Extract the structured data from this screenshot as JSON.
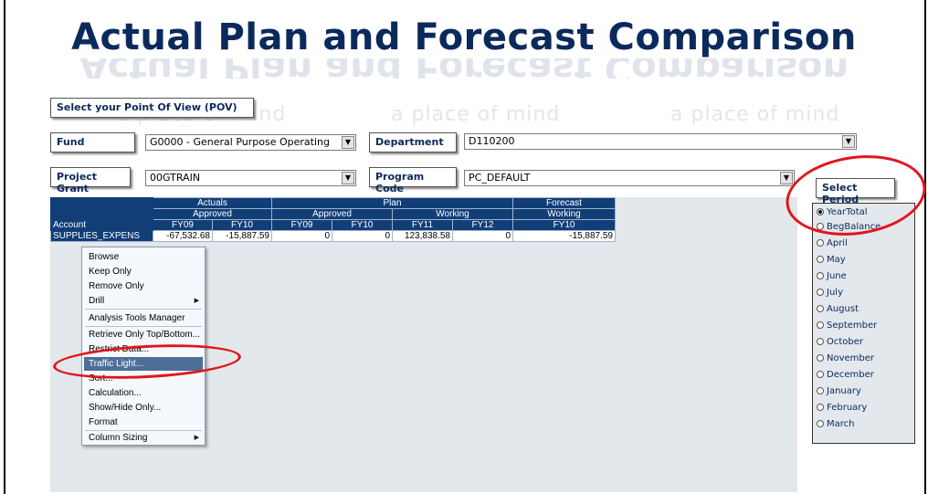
{
  "title": "Actual Plan and Forecast Comparison",
  "watermark": "a place of mind",
  "pov": {
    "label": "Select your Point Of View (POV)",
    "fund_label": "Fund",
    "fund_value": "G0000 - General Purpose Operating",
    "department_label": "Department",
    "department_value": "D110200",
    "project_label": "Project Grant",
    "project_value": "00GTRAIN",
    "program_label": "Program Code",
    "program_value": "PC_DEFAULT"
  },
  "grid": {
    "groups": [
      "Actuals",
      "Plan",
      "Forecast"
    ],
    "subgroups": [
      "Approved",
      "Approved",
      "Working",
      "Working"
    ],
    "account_header": "Account",
    "years": [
      "FY09",
      "FY10",
      "FY09",
      "FY10",
      "FY11",
      "FY12",
      "FY10"
    ],
    "row_label": "SUPPLIES_EXPENS",
    "row_values": [
      "-67,532.68",
      "-15,887.59",
      "0",
      "0",
      "123,838.58",
      "0",
      "-15,887.59"
    ]
  },
  "context_menu": {
    "items": [
      "Browse",
      "Keep Only",
      "Remove Only",
      "Drill",
      "Analysis Tools Manager",
      "Retrieve Only Top/Bottom...",
      "Restrict Data...",
      "Traffic Light...",
      "Sort...",
      "Calculation...",
      "Show/Hide Only...",
      "Format",
      "Column Sizing"
    ],
    "highlighted": "Traffic Light..."
  },
  "period": {
    "label": "Select Period",
    "options": [
      "YearTotal",
      "BegBalance",
      "April",
      "May",
      "June",
      "July",
      "August",
      "September",
      "October",
      "November",
      "December",
      "January",
      "February",
      "March"
    ],
    "selected": "YearTotal"
  },
  "colors": {
    "title": "#0b2a5c",
    "header": "#123e78",
    "highlight_circle": "#e0161d",
    "menu_highlight": "#4e6e9a"
  }
}
